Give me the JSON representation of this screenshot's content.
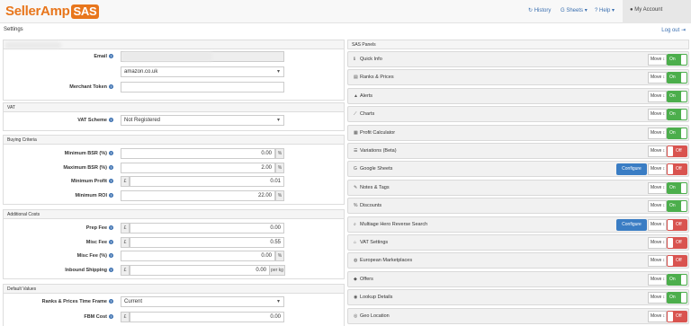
{
  "brand": {
    "name": "SellerAmp",
    "badge": "SAS"
  },
  "nav": {
    "history": "History",
    "sheets": "Sheets",
    "help": "Help",
    "account": "My Account"
  },
  "page": {
    "title": "Settings",
    "logout": "Log out"
  },
  "account": {
    "email_label": "Email",
    "marketplace": "amazon.co.uk",
    "token_label": "Merchant Token"
  },
  "vat": {
    "header": "VAT",
    "scheme_label": "VAT Scheme",
    "scheme_value": "Not Registered"
  },
  "buying": {
    "header": "Buying Criteria",
    "rows": [
      {
        "label": "Minimum BSR (%)",
        "value": "0.00",
        "suffix": "%"
      },
      {
        "label": "Maximum BSR (%)",
        "value": "2.00",
        "suffix": "%"
      },
      {
        "label": "Minimum Profit",
        "prefix": "£",
        "value": "0.01"
      },
      {
        "label": "Minimum ROI",
        "value": "22.00",
        "suffix": "%"
      }
    ]
  },
  "costs": {
    "header": "Additional Costs",
    "rows": [
      {
        "label": "Prep Fee",
        "prefix": "£",
        "value": "0.00"
      },
      {
        "label": "Misc Fee",
        "prefix": "£",
        "value": "0.55"
      },
      {
        "label": "Misc Fee (%)",
        "value": "0.00",
        "suffix": "%"
      },
      {
        "label": "Inbound Shipping",
        "prefix": "£",
        "value": "0.00",
        "suffix": "per kg"
      }
    ]
  },
  "defaults": {
    "header": "Default Values",
    "timeframe_label": "Ranks & Prices Time Frame",
    "timeframe_value": "Current",
    "fbm_label": "FBM Cost",
    "fbm_prefix": "£",
    "fbm_value": "0.00"
  },
  "sas_panels": {
    "header": "SAS Panels",
    "move": "Move",
    "configure": "Configure",
    "items": [
      {
        "label": "Quick Info",
        "icon": "info-icon",
        "glyph": "ℹ",
        "state": "On"
      },
      {
        "label": "Ranks & Prices",
        "icon": "chart-bars-icon",
        "glyph": "▤",
        "state": "On"
      },
      {
        "label": "Alerts",
        "icon": "warning-icon",
        "glyph": "▲",
        "state": "On"
      },
      {
        "label": "Charts",
        "icon": "line-chart-icon",
        "glyph": "⟋",
        "state": "On"
      },
      {
        "label": "Profit Calculator",
        "icon": "calculator-icon",
        "glyph": "▦",
        "state": "On"
      },
      {
        "label": "Variations (Beta)",
        "icon": "list-icon",
        "glyph": "☰",
        "state": "Off"
      },
      {
        "label": "Google Sheets",
        "icon": "google-icon",
        "glyph": "G",
        "state": "Off",
        "configure": true
      },
      {
        "label": "Notes & Tags",
        "icon": "notes-icon",
        "glyph": "✎",
        "state": "On"
      },
      {
        "label": "Discounts",
        "icon": "percent-icon",
        "glyph": "%",
        "state": "On"
      },
      {
        "label": "Multiage Hero Reverse Search",
        "icon": "search-icon",
        "glyph": "⌕",
        "state": "Off",
        "configure": true
      },
      {
        "label": "VAT Settings",
        "icon": "bank-icon",
        "glyph": "⌂",
        "state": "Off"
      },
      {
        "label": "European Marketplaces",
        "icon": "globe-icon",
        "glyph": "◍",
        "state": "Off"
      },
      {
        "label": "Offers",
        "icon": "tag-icon",
        "glyph": "◆",
        "state": "On"
      },
      {
        "label": "Lookup Details",
        "icon": "eye-icon",
        "glyph": "◉",
        "state": "On"
      },
      {
        "label": "Geo Location",
        "icon": "location-icon",
        "glyph": "◎",
        "state": "Off"
      }
    ]
  }
}
